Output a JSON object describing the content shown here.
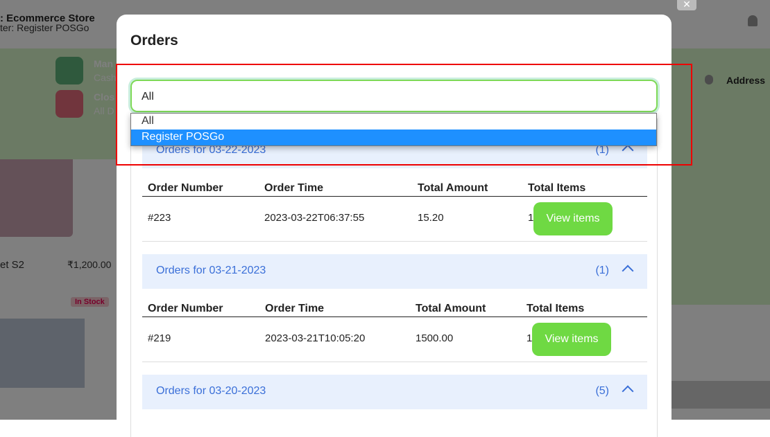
{
  "background": {
    "store": ": Ecommerce Store",
    "register": "ter: Register POSGo",
    "card1_title": "Man",
    "card1_sub": "Cash",
    "card2_title": "Clos",
    "card2_sub": "All D",
    "product_name": "et S2",
    "product_price": "₹1,200.00",
    "stock_badge": "In Stock",
    "address_label": "Address"
  },
  "modal": {
    "title": "Orders",
    "select_value": "All",
    "options": [
      "All",
      "Register POSGo"
    ],
    "selected_option": "Register POSGo",
    "columns": [
      "Order Number",
      "Order Time",
      "Total Amount",
      "Total Items"
    ],
    "view_label": "View items",
    "sections": [
      {
        "header": "Orders for 03-22-2023",
        "count": "(1)",
        "rows": [
          {
            "number": "#223",
            "time": "2023-03-22T06:37:55",
            "amount": "15.20",
            "items": "1"
          }
        ]
      },
      {
        "header": "Orders for 03-21-2023",
        "count": "(1)",
        "rows": [
          {
            "number": "#219",
            "time": "2023-03-21T10:05:20",
            "amount": "1500.00",
            "items": "1"
          }
        ]
      },
      {
        "header": "Orders for 03-20-2023",
        "count": "(5)"
      }
    ]
  },
  "colors": {
    "accent_green": "#6fd943",
    "option_highlight": "#1e90ff",
    "section_text": "#3a6fd8",
    "annotation_red": "#ee0000"
  }
}
